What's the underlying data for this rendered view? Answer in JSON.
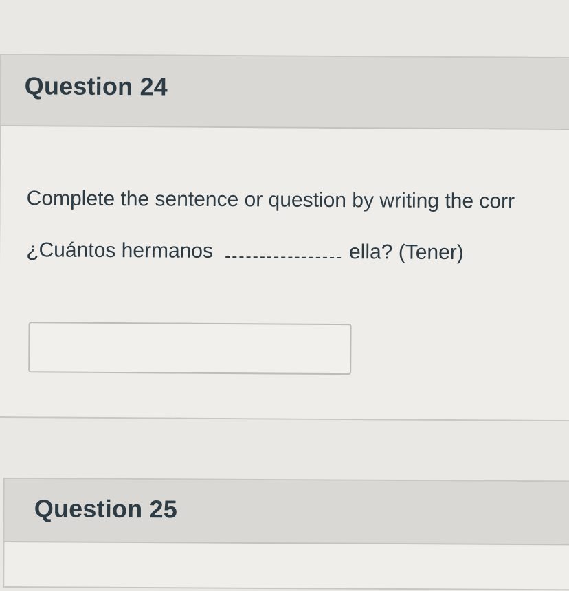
{
  "questions": [
    {
      "title": "Question 24",
      "prompt": "Complete the sentence or question by writing the corr",
      "sentence_before": "¿Cuántos hermanos",
      "sentence_after": "ella? (Tener)",
      "answer_value": ""
    },
    {
      "title": "Question 25"
    }
  ]
}
